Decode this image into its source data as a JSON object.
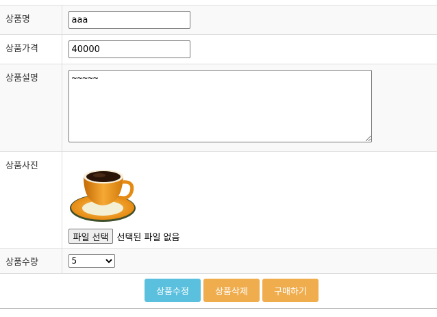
{
  "form": {
    "name_label": "상품명",
    "name_value": "aaa",
    "price_label": "상품가격",
    "price_value": "40000",
    "desc_label": "상품설명",
    "desc_value": "~~~~~",
    "photo_label": "상품사진",
    "photo_icon": "coffee-cup-image",
    "file_button": "파일 선택",
    "file_status": "선택된 파일 없음",
    "qty_label": "상품수량",
    "qty_value": "5"
  },
  "actions": {
    "edit_label": "상품수정",
    "delete_label": "상품삭제",
    "buy_label": "구매하기"
  },
  "colors": {
    "info": "#5bc0de",
    "warning": "#f0ad4e",
    "row_alt": "#f9f9f9",
    "border": "#dddddd"
  }
}
